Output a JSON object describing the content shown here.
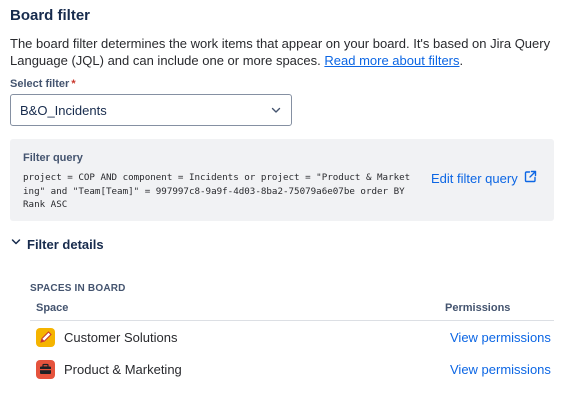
{
  "header": {
    "title": "Board filter",
    "description": "The board filter determines the work items that appear on your board. It's based on Jira Query Language (JQL) and can include one or more spaces.",
    "read_more_link": "Read more about filters"
  },
  "select_filter": {
    "label": "Select filter",
    "required_marker": "*",
    "value": "B&O_Incidents"
  },
  "filter_query": {
    "title": "Filter query",
    "query": "project = COP AND component = Incidents or project = \"Product & Marketing\" and \"Team[Team]\" = 997997c8-9a9f-4d03-8ba2-75079a6e07be order BY Rank ASC",
    "edit_label": "Edit filter query"
  },
  "filter_details": {
    "toggle_label": "Filter details",
    "spaces_heading": "SPACES IN BOARD",
    "columns": {
      "space": "Space",
      "permissions": "Permissions"
    },
    "spaces": [
      {
        "name": "Customer Solutions",
        "permissions_link": "View permissions",
        "icon": "pencil-icon",
        "color": "#f5b400"
      },
      {
        "name": "Product & Marketing",
        "permissions_link": "View permissions",
        "icon": "briefcase-icon",
        "color": "#e5533d"
      }
    ]
  },
  "colors": {
    "link": "#0c66e4",
    "text": "#292a2e",
    "query_bg": "#f1f2f4"
  }
}
